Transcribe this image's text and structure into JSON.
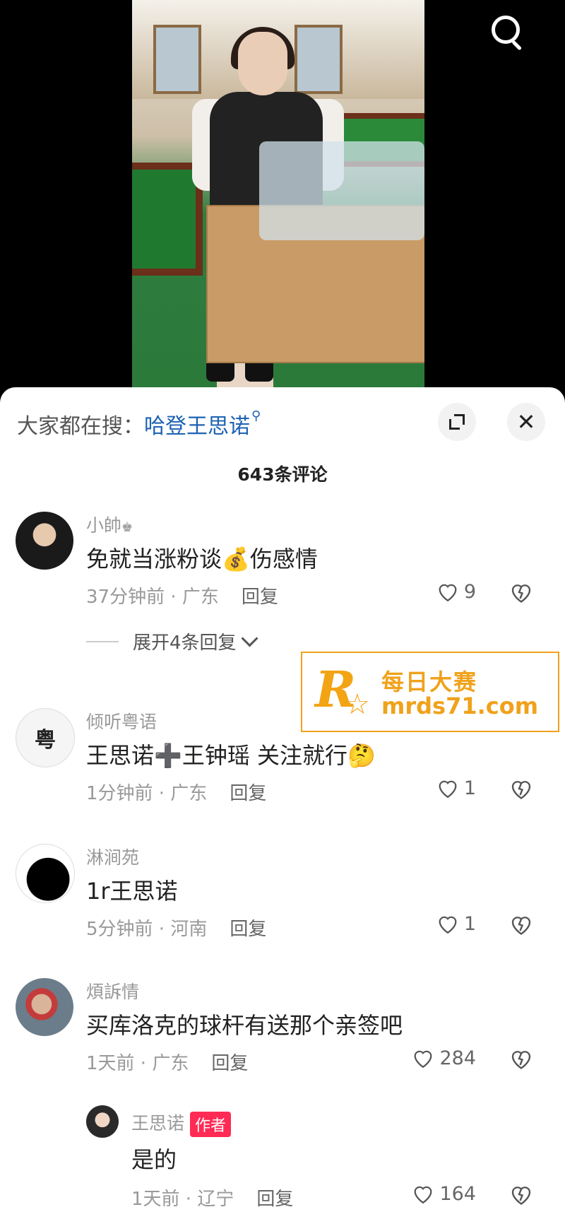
{
  "video": {
    "description_icon": "video-frame"
  },
  "top_bar": {
    "search_icon": "search-icon"
  },
  "sheet": {
    "search_prefix": "大家都在搜：",
    "search_keyword": "哈登王思诺",
    "comment_count": "643条评论"
  },
  "comments": [
    {
      "user": "小帥",
      "user_suffix": "♚",
      "text": "免就当涨粉谈💰伤感情",
      "time_loc": "37分钟前 · 广东",
      "reply": "回复",
      "likes": "9",
      "expand": "展开4条回复"
    },
    {
      "user": "倾听粤语",
      "text": "王思诺➕王钟瑶   关注就行🤔",
      "time_loc": "1分钟前 · 广东",
      "reply": "回复",
      "likes": "1"
    },
    {
      "user": "淋涧苑",
      "text": "1r王思诺",
      "time_loc": "5分钟前 · 河南",
      "reply": "回复",
      "likes": "1"
    },
    {
      "user": "煩訴情",
      "text": "买库洛克的球杆有送那个亲签吧",
      "time_loc": "1天前 · 广东",
      "reply": "回复",
      "likes": "284"
    }
  ],
  "author_reply": {
    "user": "王思诺",
    "badge": "作者",
    "text": "是的",
    "time_loc": "1天前 · 辽宁",
    "reply": "回复",
    "likes": "164"
  },
  "watermark": {
    "logo": "R",
    "cn": "每日大赛",
    "url": "mrds71.com"
  },
  "colors": {
    "accent_blue": "#1c62b3",
    "badge_red": "#ff2b55",
    "watermark_orange": "#f0a21c"
  }
}
